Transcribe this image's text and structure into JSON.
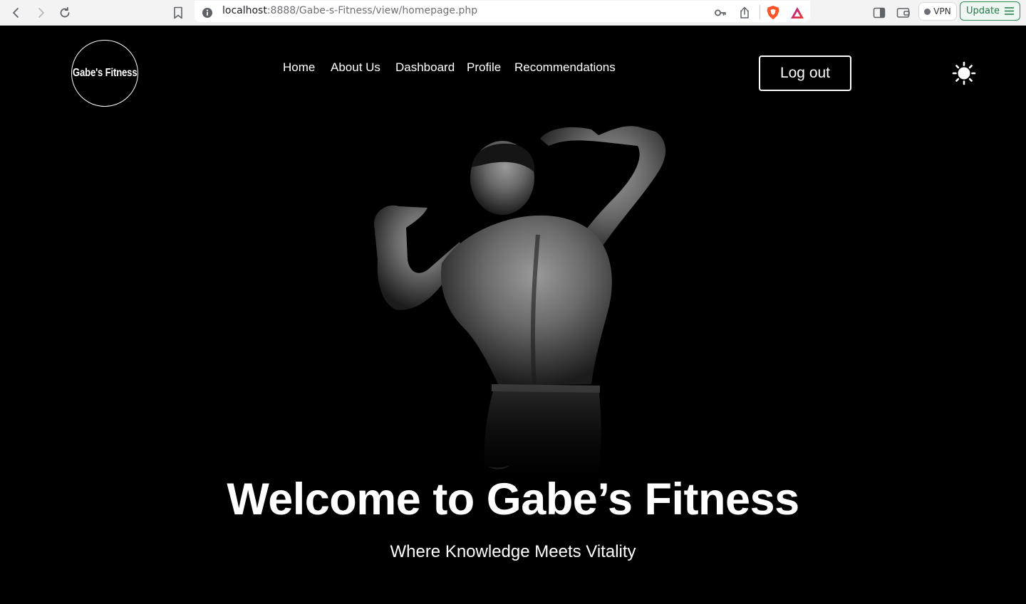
{
  "browser": {
    "url_host": "localhost",
    "url_rest": ":8888/Gabe-s-Fitness/view/homepage.php",
    "vpn_label": "VPN",
    "update_label": "Update",
    "icons": [
      "back-icon",
      "forward-icon",
      "reload-icon",
      "bookmark-icon",
      "site-info-icon",
      "key-icon",
      "share-icon",
      "brave-shields-icon",
      "brave-rewards-icon",
      "sidebar-icon",
      "wallet-icon",
      "menu-icon"
    ]
  },
  "site": {
    "logo_text": "Gabe's Fitness",
    "nav": [
      "Home",
      "About Us",
      "Dashboard",
      "Profile",
      "Recommendations"
    ],
    "logout_label": "Log out",
    "theme_icon": "sun-icon"
  },
  "hero": {
    "title": "Welcome to Gabe’s Fitness",
    "subtitle": "Where Knowledge Meets Vitality",
    "image": "bodybuilder-back-pose"
  }
}
